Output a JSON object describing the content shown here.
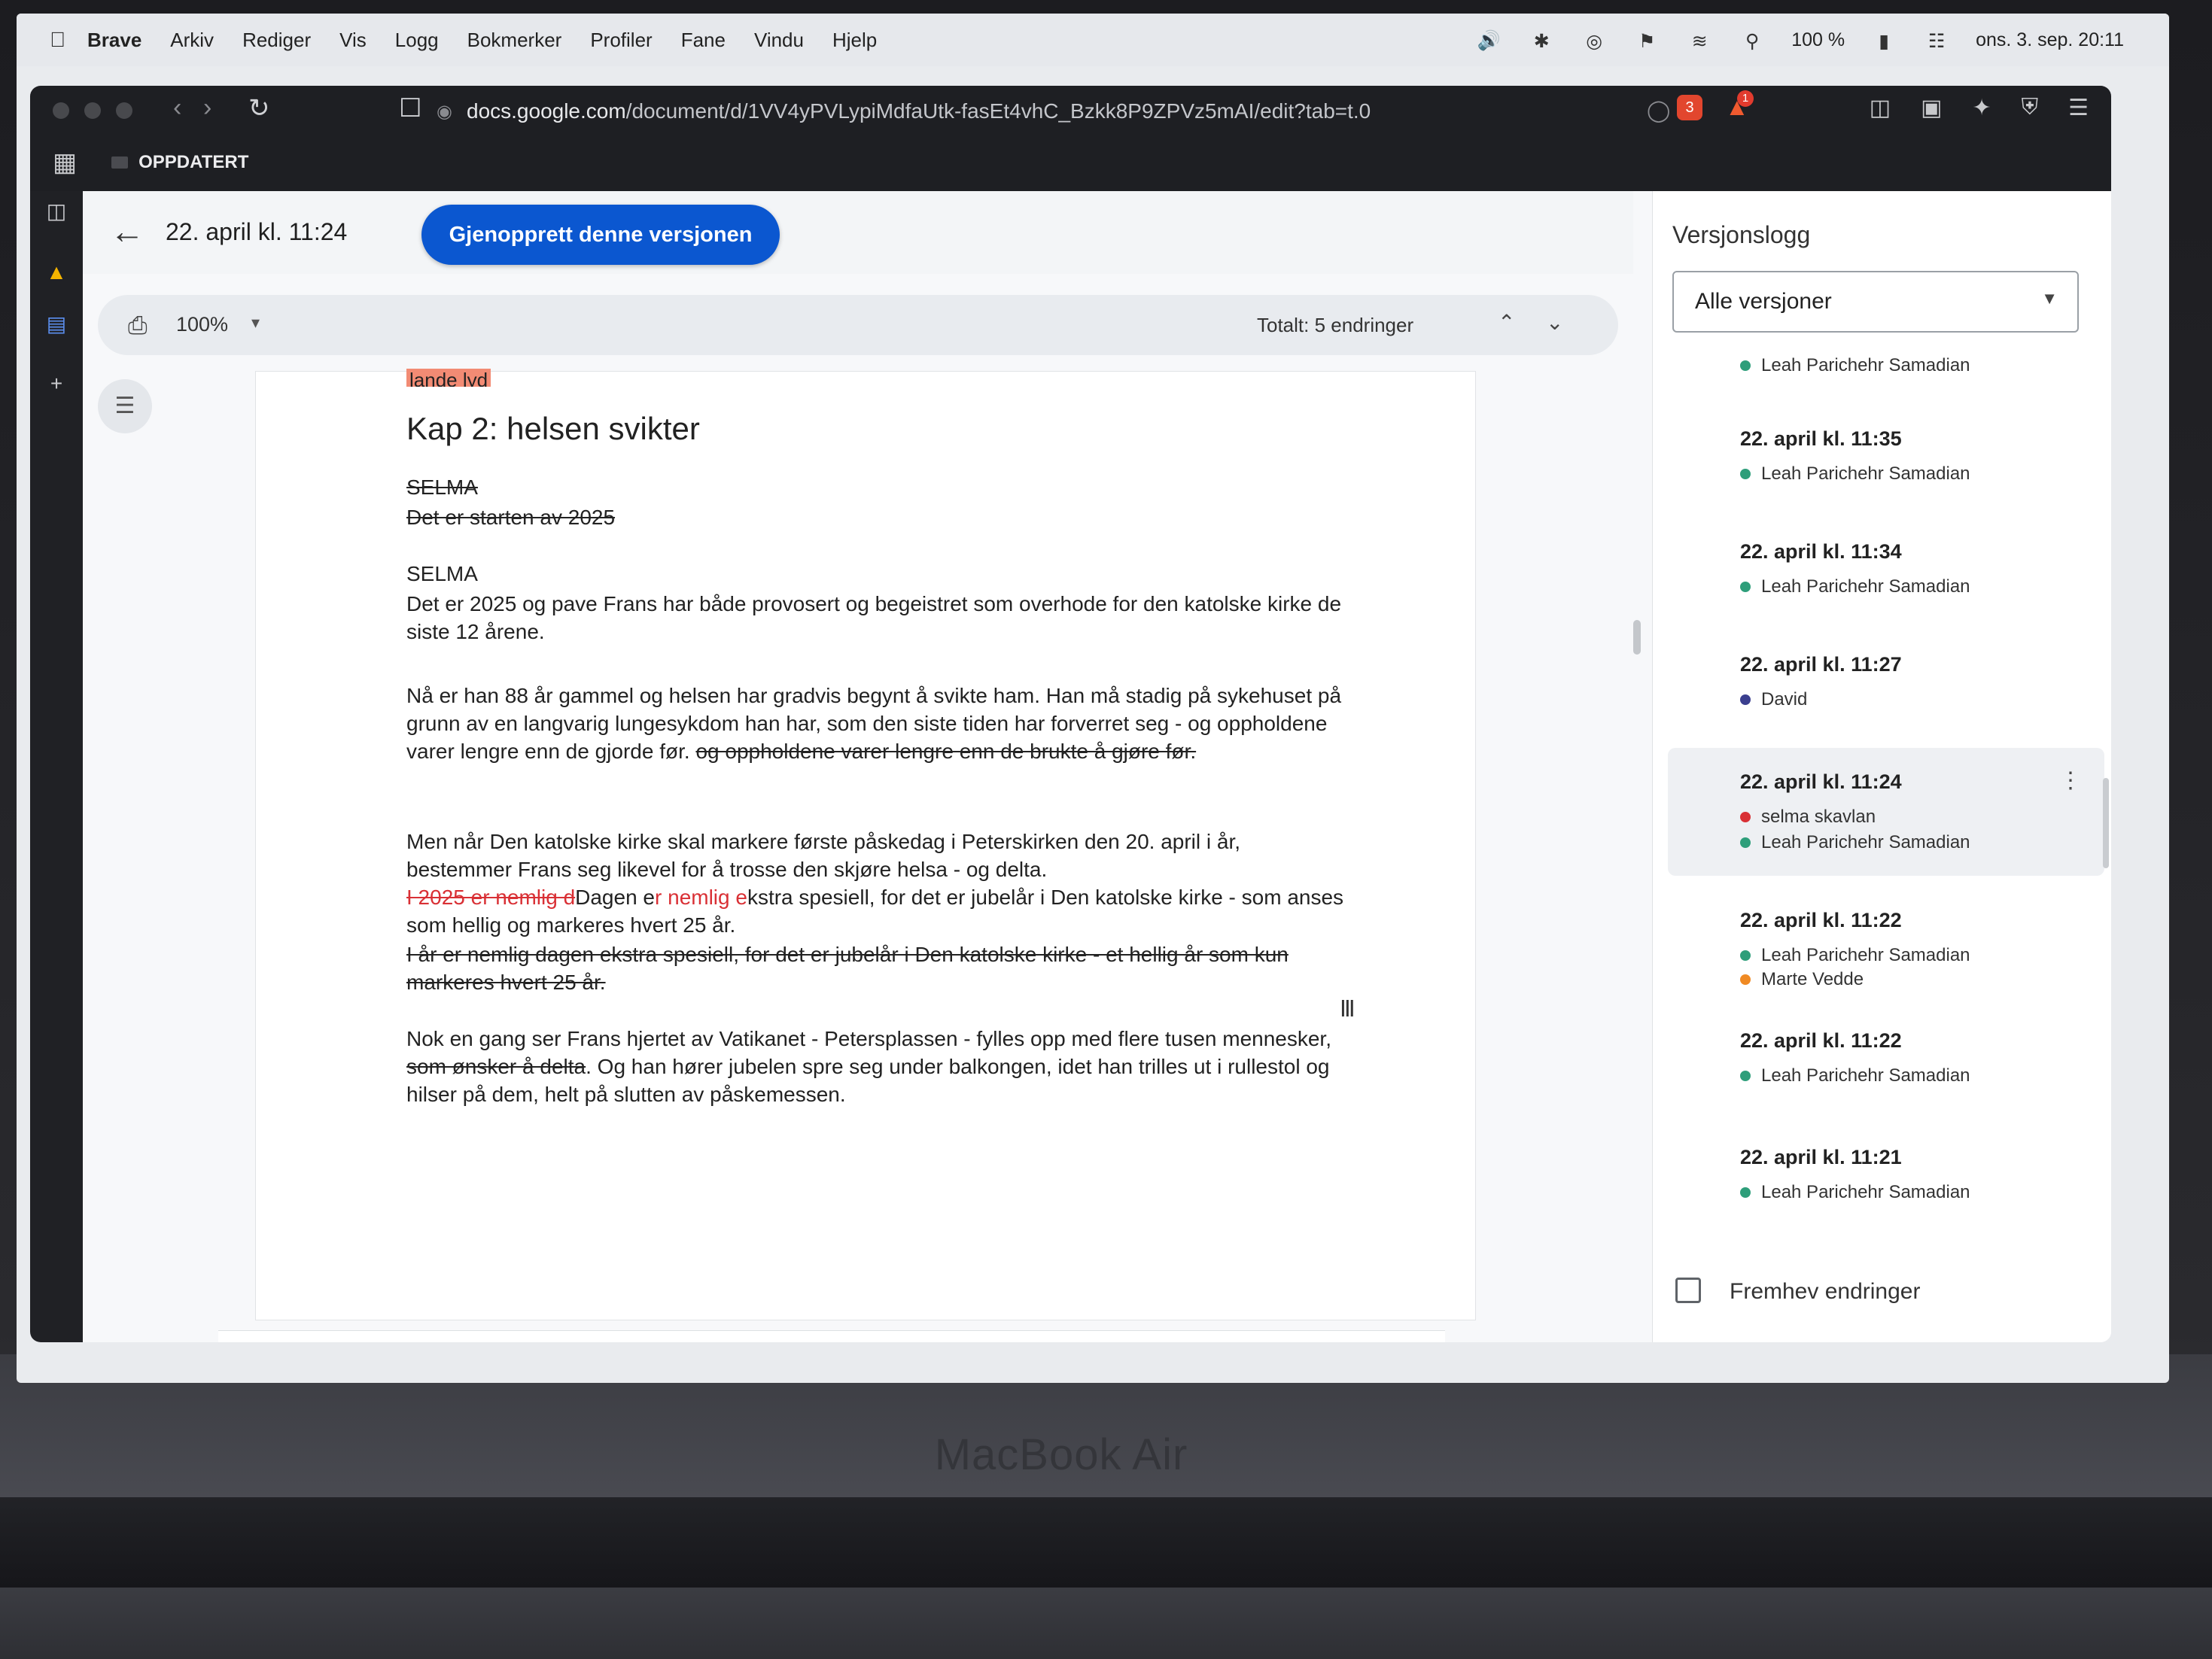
{
  "menubar": {
    "app": "Brave",
    "items": [
      "Arkiv",
      "Rediger",
      "Vis",
      "Logg",
      "Bokmerker",
      "Profiler",
      "Fane",
      "Vindu",
      "Hjelp"
    ],
    "battery": "100 %",
    "clock": "ons. 3. sep.  20:11"
  },
  "browser": {
    "url_host": "docs.google.com",
    "url_path": "/document/d/1VV4yPVLypiMdfaUtk-fasEt4vhC_Bzkk8P9ZPVz5mAI/edit?tab=t.0",
    "shield_count": "3",
    "alert_count": "1",
    "bookmark_folder": "OPPDATERT"
  },
  "doc_header": {
    "version_title": "22. april kl. 11:24",
    "restore_button": "Gjenopprett denne versjonen"
  },
  "toolbar": {
    "zoom": "100%",
    "total_changes": "Totalt: 5 endringer"
  },
  "document": {
    "cut_text": "lande lyd",
    "heading": "Kap 2: helsen svikter",
    "selma_old_1": "SELMA",
    "selma_old_2": "Det er starten av 2025",
    "selma_new": "SELMA",
    "p1": "Det er 2025 og pave Frans har både provosert og begeistret som overhode for den katolske kirke de siste 12 årene.",
    "p2_kept": "Nå er han 88 år gammel og helsen har gradvis begynt å svikte ham. Han må stadig på sykehuset på grunn av en langvarig lungesykdom han har, som den siste tiden har forverret seg - og oppholdene varer lengre enn de gjorde før.",
    "p2_deleted": "og oppholdene varer lengre enn de brukte å gjøre før.",
    "p3": "Men når Den katolske kirke skal markere første påskedag i Peterskirken den 20. april i år, bestemmer Frans seg likevel for å trosse den skjøre helsa - og delta.",
    "p4_del_a": "I 2025 er nemlig d",
    "p4_text_a": "Dagen e",
    "p4_ins_a": "r nemlig e",
    "p4_text_b": "kstra spesiell, for det er jubelår i Den katolske kirke - som anses som hellig og markeres hvert 25 år.",
    "p5_deleted": "I år er nemlig dagen ekstra spesiell, for det er jubelår i Den katolske kirke - et hellig år som kun markeres hvert 25 år.",
    "p6_a": "Nok en gang ser Frans hjertet av Vatikanet - Petersplassen - fylles opp med flere tusen mennesker,",
    "p6_deleted": "som ønsker å delta",
    "p6_b": ". Og han hører jubelen spre seg under balkongen, idet han trilles ut i rullestol og hilser på dem, helt på slutten av påskemessen."
  },
  "version_panel": {
    "title": "Versjonslogg",
    "filter": "Alle versjoner",
    "versions": [
      {
        "time": "",
        "authors": [
          {
            "name": "Leah Parichehr Samadian",
            "color": "#2e9e7a"
          }
        ]
      },
      {
        "time": "22. april kl. 11:35",
        "authors": [
          {
            "name": "Leah Parichehr Samadian",
            "color": "#2e9e7a"
          }
        ]
      },
      {
        "time": "22. april kl. 11:34",
        "authors": [
          {
            "name": "Leah Parichehr Samadian",
            "color": "#2e9e7a"
          }
        ]
      },
      {
        "time": "22. april kl. 11:27",
        "authors": [
          {
            "name": "David",
            "color": "#3b3f8f"
          }
        ]
      },
      {
        "time": "22. april kl. 11:24",
        "selected": true,
        "authors": [
          {
            "name": "selma skavlan",
            "color": "#d93035"
          },
          {
            "name": "Leah Parichehr Samadian",
            "color": "#2e9e7a"
          }
        ]
      },
      {
        "time": "22. april kl. 11:22",
        "authors": [
          {
            "name": "Leah Parichehr Samadian",
            "color": "#2e9e7a"
          },
          {
            "name": "Marte Vedde",
            "color": "#f08a24"
          }
        ]
      },
      {
        "time": "22. april kl. 11:22",
        "authors": [
          {
            "name": "Leah Parichehr Samadian",
            "color": "#2e9e7a"
          }
        ]
      },
      {
        "time": "22. april kl. 11:21",
        "authors": [
          {
            "name": "Leah Parichehr Samadian",
            "color": "#2e9e7a"
          }
        ]
      }
    ],
    "highlight_label": "Fremhev endringer"
  },
  "device": {
    "label": "MacBook Air"
  }
}
